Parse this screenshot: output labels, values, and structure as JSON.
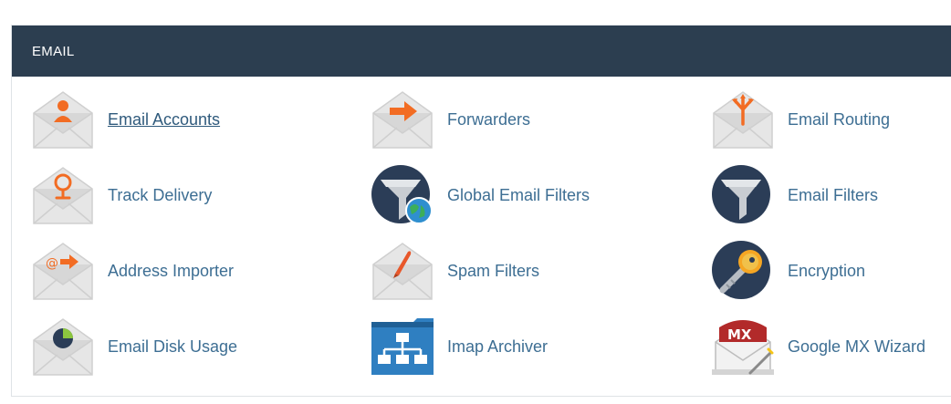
{
  "section": {
    "title": "EMAIL"
  },
  "items": [
    {
      "label": "Email Accounts",
      "icon": "email-accounts-icon"
    },
    {
      "label": "Forwarders",
      "icon": "forwarders-icon"
    },
    {
      "label": "Email Routing",
      "icon": "email-routing-icon"
    },
    {
      "label": "Track Delivery",
      "icon": "track-delivery-icon"
    },
    {
      "label": "Global Email Filters",
      "icon": "global-email-filters-icon"
    },
    {
      "label": "Email Filters",
      "icon": "email-filters-icon"
    },
    {
      "label": "Address Importer",
      "icon": "address-importer-icon"
    },
    {
      "label": "Spam Filters",
      "icon": "spam-filters-icon"
    },
    {
      "label": "Encryption",
      "icon": "encryption-icon"
    },
    {
      "label": "Email Disk Usage",
      "icon": "email-disk-usage-icon"
    },
    {
      "label": "Imap Archiver",
      "icon": "imap-archiver-icon"
    },
    {
      "label": "Google MX Wizard",
      "icon": "google-mx-wizard-icon"
    }
  ],
  "icon_badges": {
    "at_sign": "@",
    "mx": "MX"
  },
  "colors": {
    "header_bg": "#2c3e50",
    "link": "#3d6e93",
    "accent_orange": "#f26c23",
    "envelope_gray": "#e9e9e9",
    "filter_navy": "#2b3d57"
  }
}
